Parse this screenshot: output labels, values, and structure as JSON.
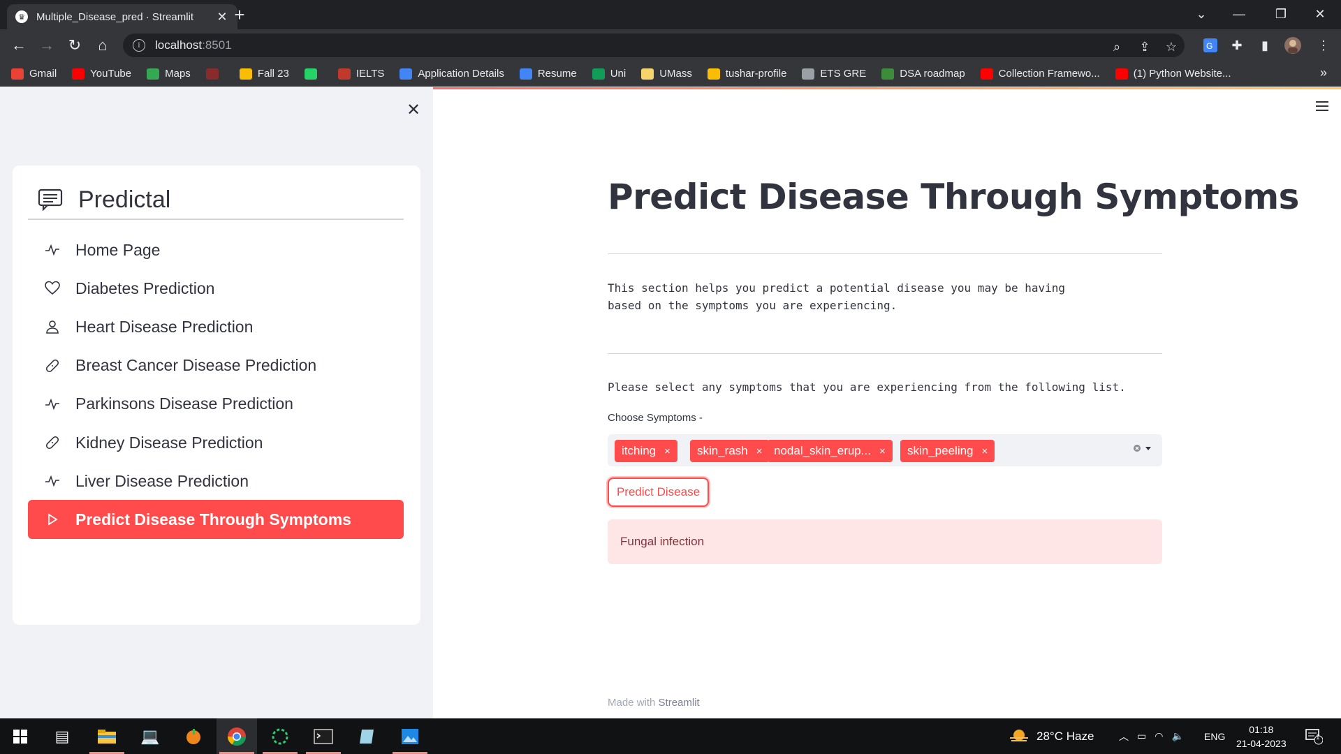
{
  "browser": {
    "tab_title": "Multiple_Disease_pred · Streamlit",
    "tab_close": "✕",
    "new_tab": "+",
    "url_host": "localhost",
    "url_port": ":8501",
    "window_controls": {
      "minimize": "—",
      "restore": "❐",
      "close": "✕"
    }
  },
  "bookmarks": [
    {
      "label": "Gmail",
      "color": "#ea4335"
    },
    {
      "label": "YouTube",
      "color": "#ff0000"
    },
    {
      "label": "Maps",
      "color": "#34a853"
    },
    {
      "label": "",
      "color": "#8a2b2b"
    },
    {
      "label": "Fall 23",
      "color": "#fbbc04"
    },
    {
      "label": "",
      "color": "#25d366"
    },
    {
      "label": "IELTS",
      "color": "#c0392b"
    },
    {
      "label": "Application Details",
      "color": "#4285f4"
    },
    {
      "label": "Resume",
      "color": "#4285f4"
    },
    {
      "label": "Uni",
      "color": "#0f9d58"
    },
    {
      "label": "UMass",
      "color": "#f6d36b"
    },
    {
      "label": "tushar-profile",
      "color": "#fbbc04"
    },
    {
      "label": "ETS GRE",
      "color": "#9aa0a6"
    },
    {
      "label": "DSA roadmap",
      "color": "#3c8c3c"
    },
    {
      "label": "Collection Framewo...",
      "color": "#ff0000"
    },
    {
      "label": "(1) Python Website...",
      "color": "#ff0000"
    }
  ],
  "bookmarks_more": "»",
  "sidebar": {
    "close": "✕",
    "menu_title": "Predictal",
    "items": [
      {
        "label": "Home Page",
        "icon": "activity-icon"
      },
      {
        "label": "Diabetes Prediction",
        "icon": "heart-icon"
      },
      {
        "label": "Heart Disease Prediction",
        "icon": "person-icon"
      },
      {
        "label": "Breast Cancer Disease Prediction",
        "icon": "bandaid-icon"
      },
      {
        "label": "Parkinsons Disease Prediction",
        "icon": "activity-icon"
      },
      {
        "label": "Kidney Disease Prediction",
        "icon": "bandaid-icon"
      },
      {
        "label": "Liver Disease Prediction",
        "icon": "activity-icon"
      },
      {
        "label": "Predict Disease Through Symptoms",
        "icon": "play-icon",
        "active": true
      }
    ]
  },
  "main": {
    "title": "Predict Disease Through Symptoms",
    "description": "This section helps you predict a potential disease you may be having\nbased on the symptoms you are experiencing.",
    "instruction": "Please select any symptoms that you are experiencing from the following list.",
    "select_label": "Choose Symptoms -",
    "chips": [
      "itching",
      "skin_rash",
      "nodal_skin_erup...",
      "skin_peeling"
    ],
    "chip_remove": "×",
    "button": "Predict Disease",
    "result": "Fungal infection",
    "footer_prefix": "Made with",
    "footer_brand": "Streamlit"
  },
  "taskbar": {
    "weather": "28°C  Haze",
    "language": "ENG",
    "time": "01:18",
    "date": "21-04-2023",
    "notification_count": "1"
  },
  "colors": {
    "accent": "#ff4b4b",
    "sidebar_bg": "#f0f2f6",
    "alert_bg": "#ffe6e6",
    "alert_text": "#7d353b"
  }
}
